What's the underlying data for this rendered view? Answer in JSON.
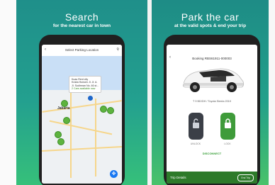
{
  "panel1": {
    "headline": "Search",
    "subhead": "for the nearest car in town",
    "app_title": "Select Parking Location",
    "tooltip_lines": [
      "Kuas Rent city",
      "Kraba Honsen Jl. Jl. A.",
      "Jl. Sudirman No. 46 st...",
      "2 Cars available now"
    ],
    "city_label": "Jakarta"
  },
  "panel2": {
    "headline": "Park the car",
    "subhead": "at the valid spots & end your trip",
    "booking_title": "Booking RBS61911-000003",
    "plate": "T 9 BD/DH / Toyota Sienta 2019",
    "key_locked_label": "UNLOCK",
    "key_unlocked_label": "LOCK",
    "disconnect_label": "DISCONNECT",
    "trip_label": "Trip Details",
    "trip_button": "End Trip"
  },
  "colors": {
    "teal": "#1f8f8a",
    "green": "#36c07a",
    "pin_green": "#5db33e",
    "dark_green_bar": "#2d7a2a"
  }
}
